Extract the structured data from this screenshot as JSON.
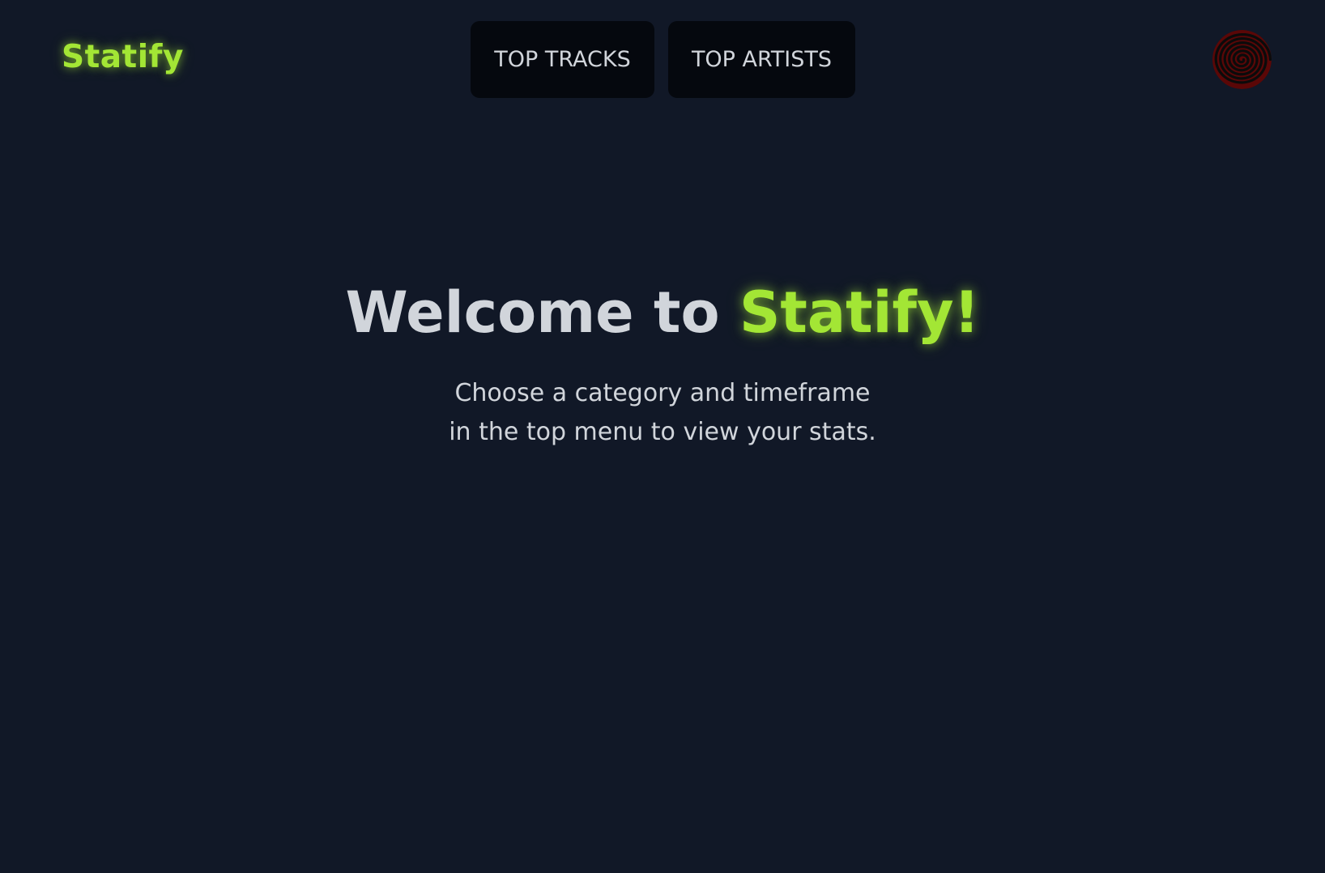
{
  "header": {
    "logo": "Statify",
    "nav": [
      {
        "label": "TOP TRACKS"
      },
      {
        "label": "TOP ARTISTS"
      }
    ],
    "avatar_icon": "spiral-avatar-icon"
  },
  "hero": {
    "title_prefix": "Welcome to ",
    "title_brand": "Statify!",
    "subtitle_line1": "Choose a category and timeframe",
    "subtitle_line2": "in the top menu to view your stats."
  },
  "colors": {
    "background": "#111827",
    "accent": "#a3e635",
    "text": "#d1d5db",
    "button_bg": "#05080e"
  }
}
